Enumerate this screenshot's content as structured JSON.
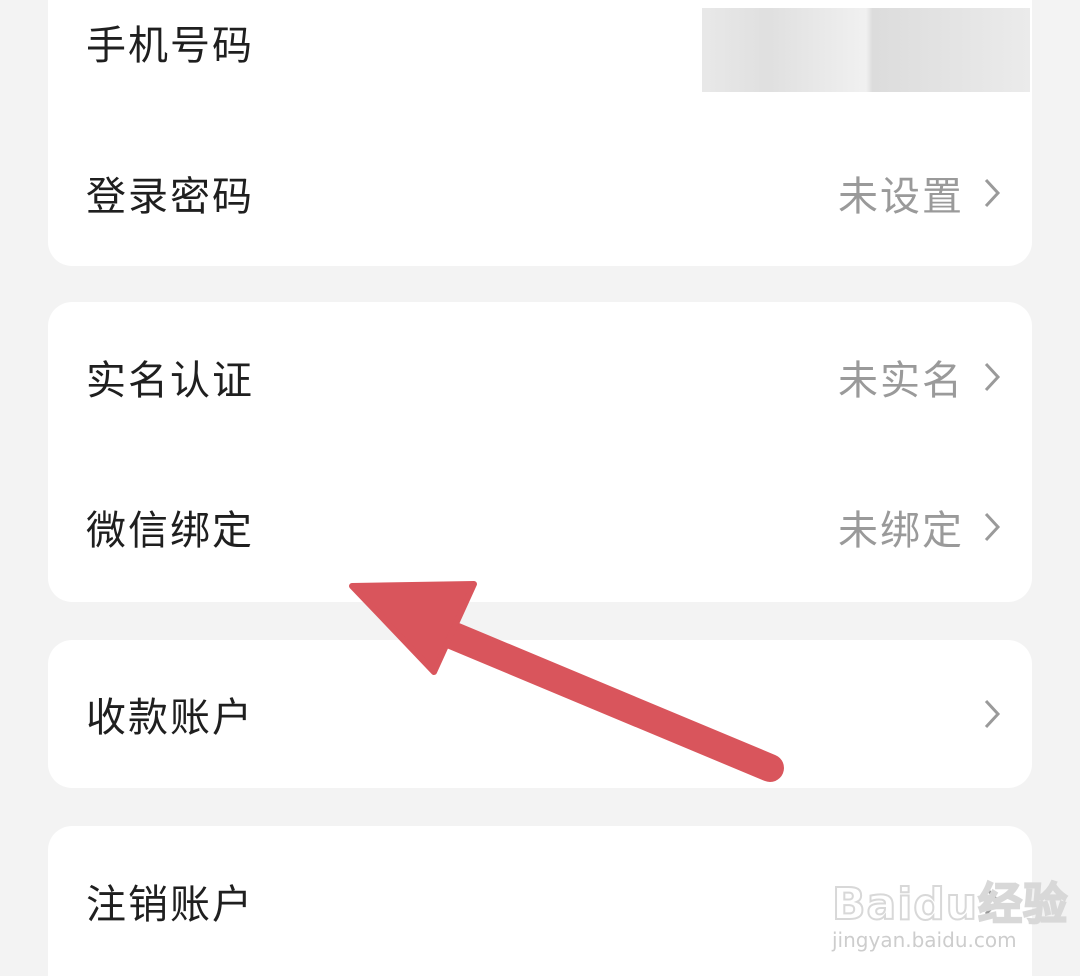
{
  "security_list": {
    "groups": [
      {
        "rows": [
          {
            "label": "手机号码",
            "value": "",
            "masked": true
          },
          {
            "label": "登录密码",
            "value": "未设置"
          }
        ]
      },
      {
        "rows": [
          {
            "label": "实名认证",
            "value": "未实名"
          },
          {
            "label": "微信绑定",
            "value": "未绑定"
          }
        ]
      },
      {
        "rows": [
          {
            "label": "收款账户",
            "value": ""
          }
        ]
      },
      {
        "rows": [
          {
            "label": "注销账户",
            "value": ""
          }
        ]
      }
    ]
  },
  "annotation": {
    "arrow_color": "#d9555c"
  },
  "watermark": {
    "logo": "Baidu经验",
    "url": "jingyan.baidu.com"
  },
  "colors": {
    "background": "#f3f3f3",
    "card": "#ffffff",
    "label": "#1f1f1f",
    "value": "#9a9a9a"
  }
}
